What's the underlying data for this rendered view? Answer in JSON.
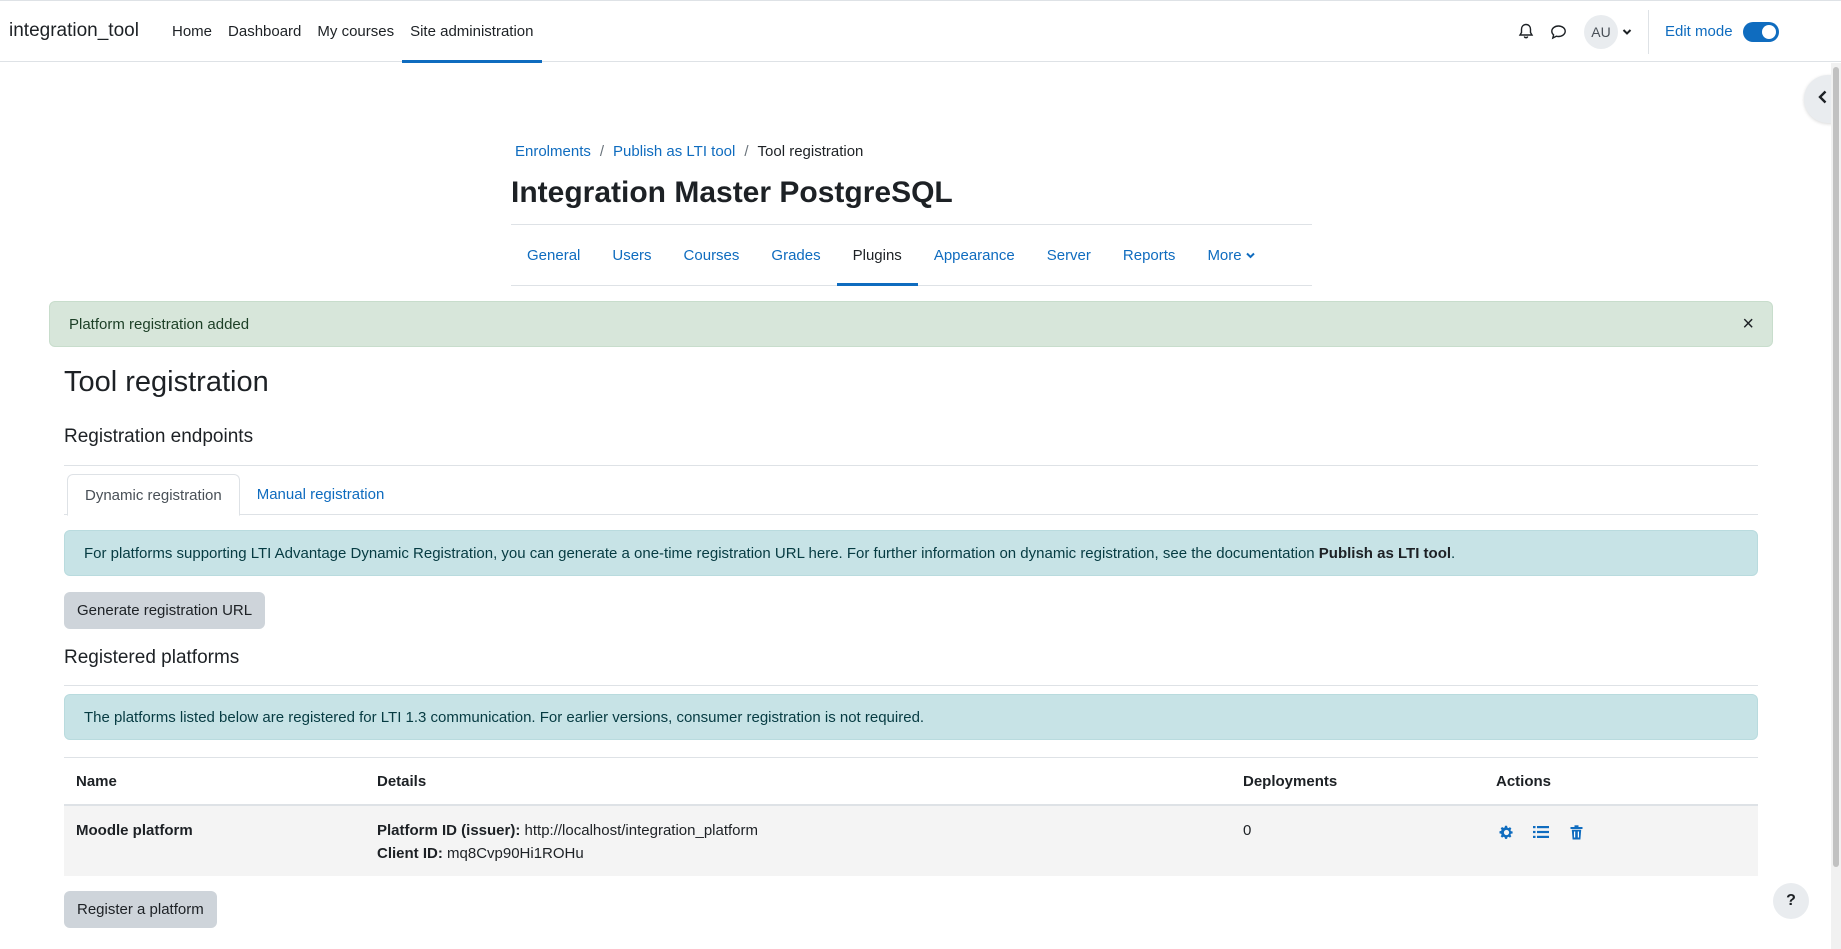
{
  "navbar": {
    "brand": "integration_tool",
    "links": [
      "Home",
      "Dashboard",
      "My courses",
      "Site administration"
    ],
    "active_link": "Site administration",
    "user_initials": "AU",
    "edit_mode_label": "Edit mode",
    "edit_mode_on": true
  },
  "breadcrumb": [
    "Enrolments",
    "Publish as LTI tool",
    "Tool registration"
  ],
  "page_heading": "Integration Master PostgreSQL",
  "secondary_nav": {
    "tabs": [
      "General",
      "Users",
      "Courses",
      "Grades",
      "Plugins",
      "Appearance",
      "Server",
      "Reports",
      "More"
    ],
    "active": "Plugins"
  },
  "alert_success": {
    "message": "Platform registration added",
    "close": "×"
  },
  "main": {
    "title": "Tool registration",
    "endpoints_heading": "Registration endpoints",
    "tabs": [
      "Dynamic registration",
      "Manual registration"
    ],
    "active_tab": "Dynamic registration",
    "dynamic_info_text": "For platforms supporting LTI Advantage Dynamic Registration, you can generate a one-time registration URL here. For further information on dynamic registration, see the documentation ",
    "dynamic_info_link": "Publish as LTI tool",
    "dynamic_info_end": ".",
    "generate_button": "Generate registration URL",
    "registered_heading": "Registered platforms",
    "registered_info": "The platforms listed below are registered for LTI 1.3 communication. For earlier versions, consumer registration is not required.",
    "register_button": "Register a platform"
  },
  "table": {
    "headers": [
      "Name",
      "Details",
      "Deployments",
      "Actions"
    ],
    "rows": [
      {
        "name": "Moodle platform",
        "platform_id_label": "Platform ID (issuer):",
        "platform_id": "http://localhost/integration_platform",
        "client_id_label": "Client ID:",
        "client_id": "mq8Cvp90Hi1ROHu",
        "deployments": "0",
        "actions": [
          "gear-icon",
          "list-icon",
          "trash-icon"
        ]
      }
    ]
  },
  "help_label": "?",
  "colors": {
    "primary": "#0f6cbf",
    "success_bg": "#d7e6da",
    "info_bg": "#c7e3e6"
  }
}
